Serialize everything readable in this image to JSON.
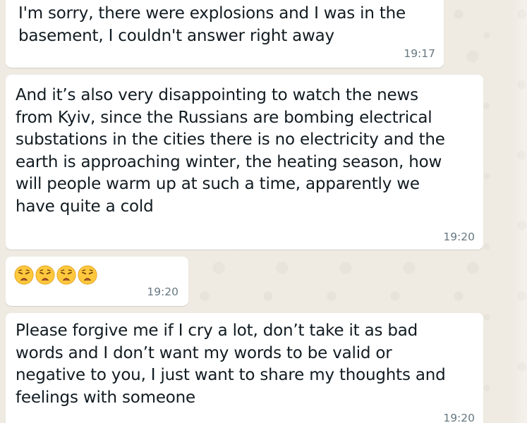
{
  "messages": [
    {
      "text": "I'm sorry, there were explosions and I was in the\nbasement, I couldn't answer right away",
      "time": "19:17"
    },
    {
      "text": "And it’s also very disappointing to watch the news\nfrom Kyiv, since the Russians are bombing electrical\nsubstations in the cities there is no electricity and the\nearth is approaching winter, the heating season, how\nwill people warm up at such a time, apparently we\nhave quite a cold",
      "time": "19:20"
    },
    {
      "emojis": [
        "weary-face",
        "weary-face",
        "weary-face",
        "weary-face"
      ],
      "time": "19:20"
    },
    {
      "text": "Please forgive me if I cry a lot, don’t take it as bad\nwords and I don’t want my words to be valid or\nnegative to you, I just want to share my thoughts and\nfeelings with someone",
      "time": "19:20"
    }
  ],
  "colors": {
    "chat_background": "#efeae2",
    "bubble_background": "#ffffff",
    "text": "#111b21",
    "timestamp": "#667781",
    "emoji_face": "#ffc83d"
  }
}
